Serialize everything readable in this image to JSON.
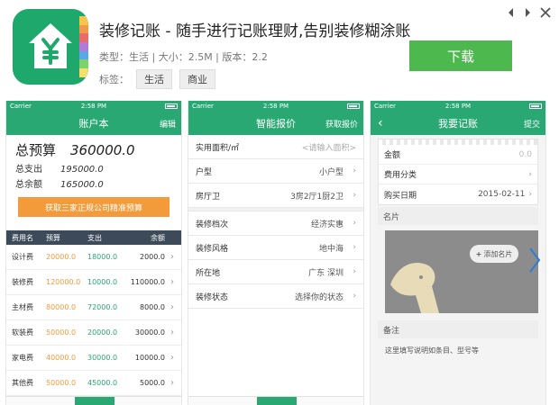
{
  "app": {
    "title": "装修记账 - 随手进行记账理财,告别装修糊涂账",
    "meta": "类型：生活 | 大小：2.5M | 版本：2.2",
    "tags_label": "标签：",
    "tags": [
      "生活",
      "商业"
    ],
    "download_label": "下载",
    "brand_color": "#2aa873",
    "icon": "house-yen-icon"
  },
  "status_bar": {
    "carrier": "Carrier",
    "time": "2:58 PM"
  },
  "phone1": {
    "nav_title": "账户本",
    "nav_action": "编辑",
    "total_label": "总预算",
    "total_value": "360000.0",
    "spent_label": "总支出",
    "spent_value": "195000.0",
    "balance_label": "总余额",
    "balance_value": "165000.0",
    "quote_button": "获取三家正规公司精准预算",
    "table_headers": [
      "费用名",
      "预算",
      "支出",
      "余额"
    ],
    "rows": [
      {
        "name": "设计费",
        "budget": "20000.0",
        "spent": "18000.0",
        "balance": "2000.0"
      },
      {
        "name": "装修费",
        "budget": "120000.0",
        "spent": "10000.0",
        "balance": "110000.0"
      },
      {
        "name": "主材费",
        "budget": "80000.0",
        "spent": "72000.0",
        "balance": "8000.0"
      },
      {
        "name": "软装费",
        "budget": "50000.0",
        "spent": "20000.0",
        "balance": "30000.0"
      },
      {
        "name": "家电费",
        "budget": "40000.0",
        "spent": "30000.0",
        "balance": "10000.0"
      },
      {
        "name": "其他费",
        "budget": "50000.0",
        "spent": "45000.0",
        "balance": "5000.0"
      }
    ]
  },
  "phone2": {
    "nav_title": "智能报价",
    "nav_action": "获取报价",
    "fields": [
      {
        "label": "实用面积/㎡",
        "placeholder": "<请输入面积>"
      },
      {
        "label": "户型",
        "value": "小户型"
      },
      {
        "label": "房厅卫",
        "value": "3房2厅1厨2卫"
      },
      {
        "label": "装修档次",
        "value": "经济实惠"
      },
      {
        "label": "装修风格",
        "value": "地中海"
      },
      {
        "label": "所在地",
        "value": "广东 深圳"
      },
      {
        "label": "装修状态",
        "value": "选择你的状态"
      }
    ]
  },
  "phone3": {
    "nav_title": "我要记账",
    "nav_action": "提交",
    "back": "‹",
    "amount_label": "金额",
    "amount_value": "0.0",
    "category_label": "费用分类",
    "date_label": "购买日期",
    "date_value": "2015-02-11",
    "card_section": "名片",
    "add_card": "添加名片",
    "remarks_section": "备注",
    "remarks_placeholder": "这里填写说明如条目、型号等"
  }
}
